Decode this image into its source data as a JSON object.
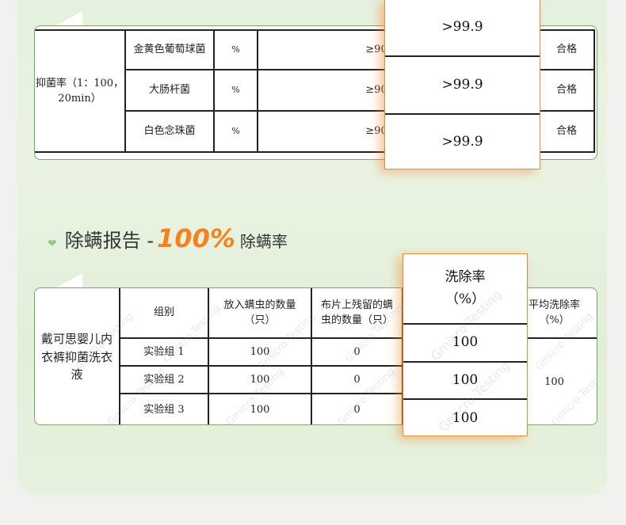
{
  "antibacterial_table": {
    "row_header": "抑菌率（1：100，20min）",
    "rows": [
      {
        "organism": "金黄色葡萄球菌",
        "unit": "%",
        "standard": "≥90",
        "result": ">99.9",
        "verdict": "合格"
      },
      {
        "organism": "大肠杆菌",
        "unit": "%",
        "standard": "≥90",
        "result": ">99.9",
        "verdict": "合格"
      },
      {
        "organism": "白色念珠菌",
        "unit": "%",
        "standard": "≥90",
        "result": ">99.9",
        "verdict": "合格"
      }
    ]
  },
  "section": {
    "title": "除螨报告 - ",
    "highlight": "100%",
    "suffix": "除螨率",
    "accent": "#f5821f"
  },
  "mite_table": {
    "product": "戴可思婴儿内衣裤抑菌洗衣液",
    "headers": [
      "组别",
      "放入螨虫的数量（只）",
      "布片上残留的螨虫的数量（只）",
      "洗除率（%）",
      "平均洗除率（%）"
    ],
    "rows": [
      {
        "group": "实验组 1",
        "placed": "100",
        "remaining": "0",
        "rate": "100"
      },
      {
        "group": "实验组 2",
        "placed": "100",
        "remaining": "0",
        "rate": "100"
      },
      {
        "group": "实验组 3",
        "placed": "100",
        "remaining": "0",
        "rate": "100"
      }
    ],
    "average": "100",
    "watermark": "Gmicro Testing"
  }
}
